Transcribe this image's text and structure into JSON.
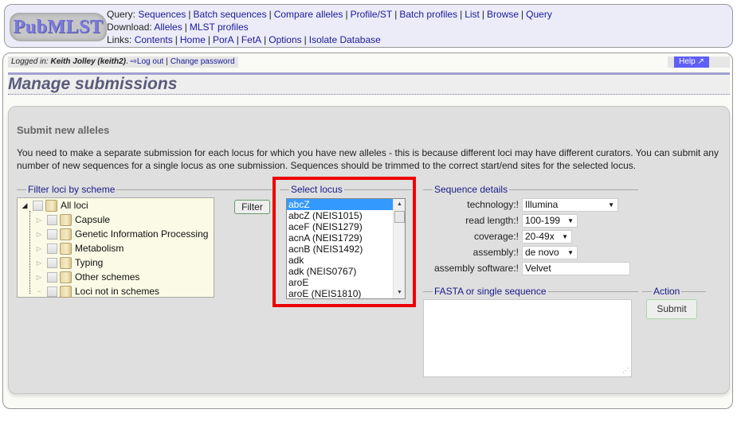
{
  "header": {
    "logo_text": "PubMLST",
    "query": {
      "label": "Query:",
      "links": [
        "Sequences",
        "Batch sequences",
        "Compare alleles",
        "Profile/ST",
        "Batch profiles",
        "List",
        "Browse",
        "Query"
      ]
    },
    "download": {
      "label": "Download:",
      "links": [
        "Alleles",
        "MLST profiles"
      ]
    },
    "links": {
      "label": "Links:",
      "links": [
        "Contents",
        "Home",
        "PorA",
        "FetA",
        "Options",
        "Isolate Database"
      ]
    }
  },
  "login_bar": {
    "prefix": "Logged in:",
    "user": "Keith Jolley (keith2)",
    "suffix": ".",
    "logout_icon": "logout-icon",
    "logout_label": "Log out",
    "change_password_label": "Change password"
  },
  "help": {
    "label": "Help",
    "icon": "external-link-icon"
  },
  "page_title": "Manage submissions",
  "section": {
    "title": "Submit new alleles",
    "intro": "You need to make a separate submission for each locus for which you have new alleles - this is because different loci may have different curators. You can submit any number of new sequences for a single locus as one submission. Sequences should be trimmed to the correct start/end sites for the selected locus."
  },
  "filter": {
    "legend": "Filter loci by scheme",
    "button_label": "Filter",
    "tree": {
      "root": "All loci",
      "children": [
        "Capsule",
        "Genetic Information Processing",
        "Metabolism",
        "Typing",
        "Other schemes",
        "Loci not in schemes"
      ]
    }
  },
  "locus": {
    "legend": "Select locus",
    "selected": "abcZ",
    "options": [
      "abcZ",
      "abcZ (NEIS1015)",
      "aceF (NEIS1279)",
      "acnA (NEIS1729)",
      "acnB (NEIS1492)",
      "adk",
      "adk (NEIS0767)",
      "aroE",
      "aroE (NEIS1810)"
    ]
  },
  "sequence_details": {
    "legend": "Sequence details",
    "fields": [
      {
        "label": "technology:!",
        "value": "Illumina",
        "type": "select"
      },
      {
        "label": "read length:!",
        "value": "100-199",
        "type": "select"
      },
      {
        "label": "coverage:!",
        "value": "20-49x",
        "type": "select"
      },
      {
        "label": "assembly:!",
        "value": "de novo",
        "type": "select"
      },
      {
        "label": "assembly software:!",
        "value": "Velvet",
        "type": "text"
      }
    ]
  },
  "fasta": {
    "legend": "FASTA or single sequence",
    "value": ""
  },
  "action": {
    "legend": "Action",
    "submit_label": "Submit"
  },
  "colors": {
    "link": "#1a1a99",
    "highlight_border": "#ee0000",
    "selected_option": "#3399ff",
    "help_button": "#5f5ff8",
    "title_text": "#5b5b7a"
  }
}
